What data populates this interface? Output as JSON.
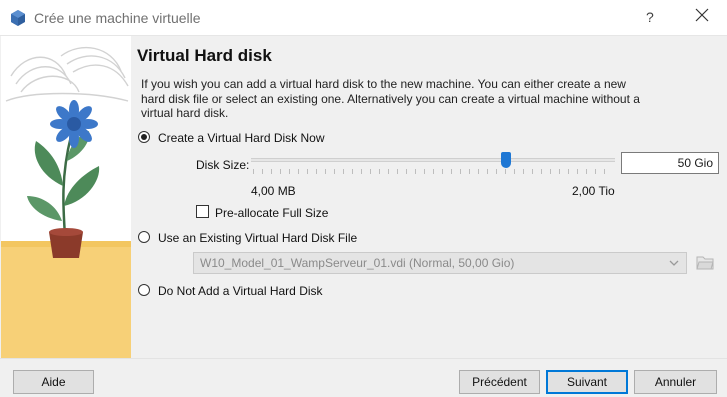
{
  "window": {
    "title": "Crée une machine virtuelle",
    "help_glyph": "?",
    "close_icon": "close-icon"
  },
  "page": {
    "heading": "Virtual Hard disk",
    "description": "If you wish you can add a virtual hard disk to the new machine. You can either create a new hard disk file or select an existing one. Alternatively you can create a virtual machine without a virtual hard disk."
  },
  "options": {
    "create_now": {
      "label": "Create a Virtual Hard Disk Now",
      "selected": true
    },
    "use_existing": {
      "label": "Use an Existing Virtual Hard Disk File",
      "selected": false
    },
    "do_not_add": {
      "label": "Do Not Add a Virtual Hard Disk",
      "selected": false
    }
  },
  "disk": {
    "size_label": "Disk Size:",
    "size_value": "50 Gio",
    "slider_min_label": "4,00 MB",
    "slider_max_label": "2,00 Tio",
    "slider_fraction": 0.7,
    "preallocate_label": "Pre-allocate Full Size",
    "preallocate_checked": false
  },
  "existing": {
    "selected_file": "W10_Model_01_WampServeur_01.vdi (Normal, 50,00 Gio)",
    "folder_icon": "folder-icon"
  },
  "buttons": {
    "help": "Aide",
    "back": "Précédent",
    "next": "Suivant",
    "cancel": "Annuler"
  },
  "colors": {
    "accent": "#1e77d4",
    "default_button_border": "#0078d7"
  }
}
